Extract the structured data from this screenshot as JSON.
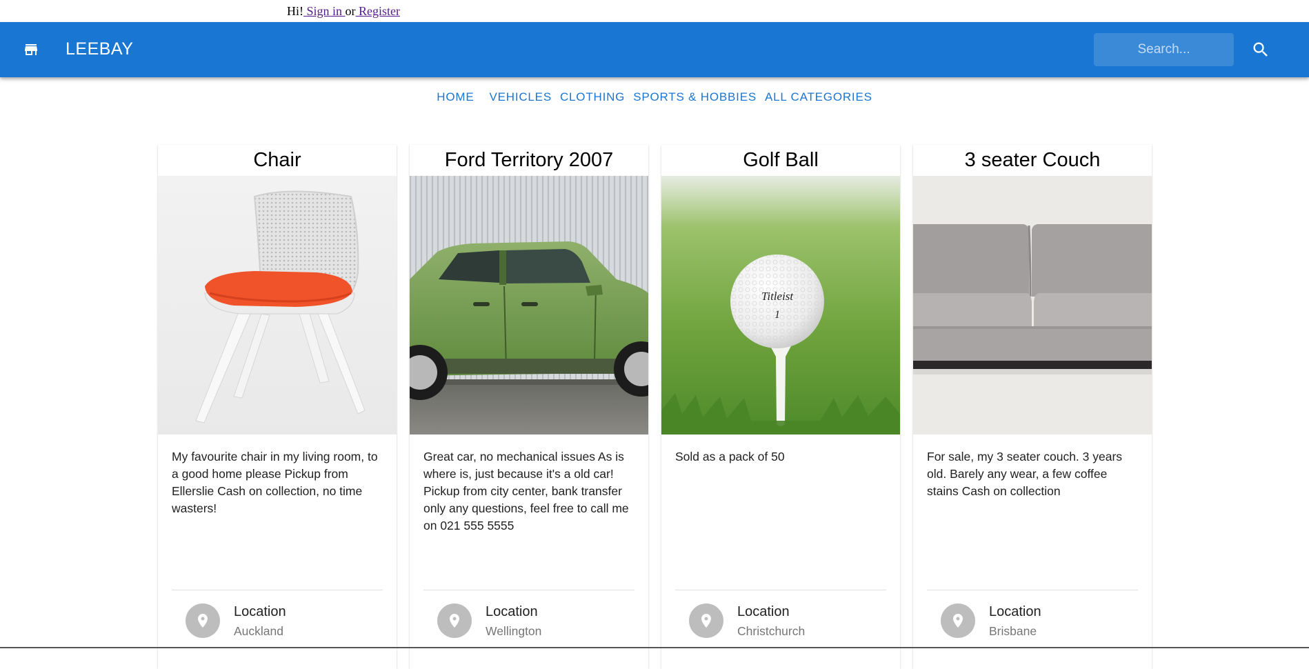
{
  "greeting": {
    "hi": "Hi!",
    "sign_in": " Sign in ",
    "or": "or",
    "register": " Register"
  },
  "appbar": {
    "brand": "LEEBAY",
    "search_placeholder": "Search...",
    "color": "#1976d2",
    "store_icon": "store-icon",
    "search_icon": "search-icon"
  },
  "nav": {
    "items": [
      "HOME",
      "VEHICLES",
      "CLOTHING",
      "SPORTS & HOBBIES",
      "ALL CATEGORIES"
    ]
  },
  "listings": [
    {
      "title": "Chair",
      "description": "My favourite chair in my living room, to a good home please Pickup from Ellerslie Cash on collection, no time wasters!",
      "location_label": "Location",
      "location": "Auckland"
    },
    {
      "title": "Ford Territory 2007",
      "description": "Great car, no mechanical issues As is where is, just because it's a old car! Pickup from city center, bank transfer only any questions, feel free to call me on 021 555 5555",
      "location_label": "Location",
      "location": "Wellington"
    },
    {
      "title": "Golf Ball",
      "description": "Sold as a pack of 50",
      "location_label": "Location",
      "location": "Christchurch"
    },
    {
      "title": "3 seater Couch",
      "description": "For sale, my 3 seater couch. 3 years old. Barely any wear, a few coffee stains Cash on collection",
      "location_label": "Location",
      "location": "Brisbane"
    }
  ]
}
